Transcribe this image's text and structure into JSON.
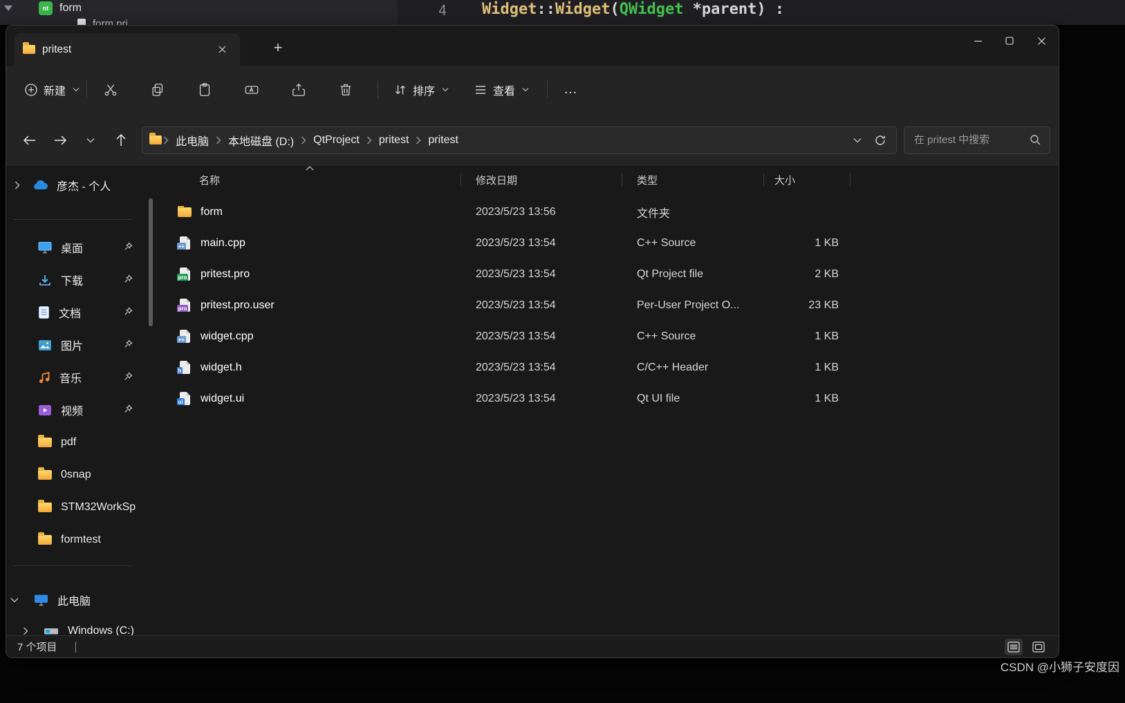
{
  "colors": {
    "folder_yellow": "#f6c74a",
    "onedrive_blue": "#2a8ae2",
    "code_yellow": "#e2c079",
    "code_green": "#43c24e",
    "window_bg": "#191919",
    "command_bg": "#242424"
  },
  "icons": {
    "plus_tab": "+",
    "more": "…"
  },
  "background": {
    "tree": {
      "root_item": "form",
      "child_item": "form.pri",
      "icon_text": "nt"
    },
    "editor": {
      "line_number": "4",
      "code": {
        "name1": "Widget",
        "scope": "::",
        "name2": "Widget",
        "open_paren": "(",
        "type_name": "QWidget",
        "params": " *parent)",
        "trailer": " :"
      }
    },
    "watermark": "CSDN @小狮子安度因"
  },
  "window": {
    "tab": {
      "title": "pritest"
    },
    "toolbar": {
      "new_label": "新建",
      "sort_label": "排序",
      "view_label": "查看"
    },
    "address": {
      "breadcrumb": [
        "此电脑",
        "本地磁盘 (D:)",
        "QtProject",
        "pritest",
        "pritest"
      ],
      "search_placeholder": "在 pritest 中搜索"
    },
    "sidebar": {
      "items": [
        {
          "label": "彦杰 - 个人"
        },
        {
          "label": "桌面"
        },
        {
          "label": "下载"
        },
        {
          "label": "文档"
        },
        {
          "label": "图片"
        },
        {
          "label": "音乐"
        },
        {
          "label": "视频"
        },
        {
          "label": "pdf"
        },
        {
          "label": "0snap"
        },
        {
          "label": "STM32WorkSp"
        },
        {
          "label": "formtest"
        },
        {
          "label": "此电脑"
        },
        {
          "label": "Windows (C:)"
        }
      ]
    },
    "files": {
      "columns": [
        "名称",
        "修改日期",
        "类型",
        "大小"
      ],
      "rows": [
        {
          "name": "form",
          "date": "2023/5/23 13:56",
          "type": "文件夹",
          "size": "",
          "badge": ""
        },
        {
          "name": "main.cpp",
          "date": "2023/5/23 13:54",
          "type": "C++ Source",
          "size": "1 KB",
          "badge": "++"
        },
        {
          "name": "pritest.pro",
          "date": "2023/5/23 13:54",
          "type": "Qt Project file",
          "size": "2 KB",
          "badge": "pro"
        },
        {
          "name": "pritest.pro.user",
          "date": "2023/5/23 13:54",
          "type": "Per-User Project O...",
          "size": "23 KB",
          "badge": "pro"
        },
        {
          "name": "widget.cpp",
          "date": "2023/5/23 13:54",
          "type": "C++ Source",
          "size": "1 KB",
          "badge": "++"
        },
        {
          "name": "widget.h",
          "date": "2023/5/23 13:54",
          "type": "C/C++ Header",
          "size": "1 KB",
          "badge": "h"
        },
        {
          "name": "widget.ui",
          "date": "2023/5/23 13:54",
          "type": "Qt UI file",
          "size": "1 KB",
          "badge": "ui"
        }
      ]
    },
    "status": {
      "count": "7 个项目"
    }
  }
}
